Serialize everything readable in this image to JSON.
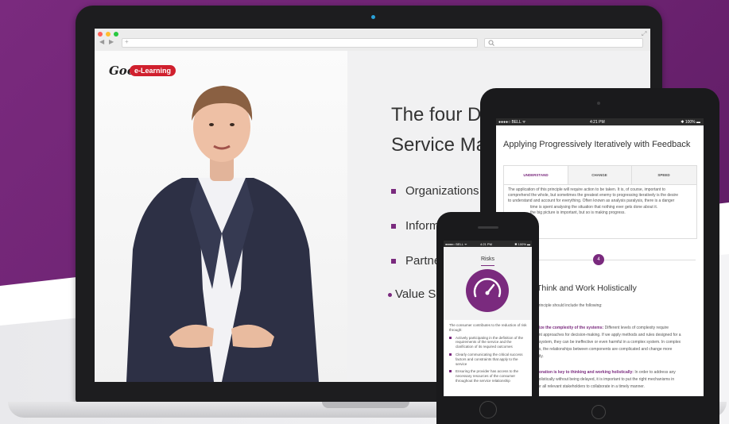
{
  "colors": {
    "brand_purple": "#7a2a7e",
    "logo_red": "#d0202e",
    "browser_close": "#ff5f57",
    "browser_min": "#ffbd2e",
    "browser_max": "#28c840"
  },
  "laptop": {
    "logo": {
      "good": "Good",
      "pill": "e-Learning"
    },
    "slide": {
      "title_line1": "The four D",
      "title_line2": "Service Ma",
      "bullets": [
        "Organizations",
        "Inform",
        "Partne",
        "Value S"
      ]
    }
  },
  "tablet": {
    "status": {
      "carrier": "●●●●○ BELL ᯤ",
      "time": "4:21 PM",
      "battery": "✱ 100% ▬"
    },
    "title": "Applying Progressively Iteratively with Feedback",
    "tabs": [
      "UNDERSTAND",
      "CHANGE",
      "SPEED"
    ],
    "panel_lines": [
      "The application of this principle will require action to be taken. It is, of course, important to",
      "comprehend the whole, but sometimes the greatest enemy to progressing iteratively is the desire",
      "to understand and account for everything. Often known as analysis paralysis, there is a danger",
      "time is spent analysing the situation that nothing ever gets done about it.",
      "the big picture is important, but so is making progress."
    ],
    "step_number": "4",
    "section_title": "Think and Work Holistically",
    "section_intro": "principle should include the following:",
    "point1_bold": "nize the complexity of the systems:",
    "point1_lines": [
      " Different levels of complexity require",
      "ent approaches for decision-making. If we apply methods and rules designed for a",
      "r system, they can be ineffective or even harmful in a complex system. In complex",
      "ns, the relationships between components are complicated and change more",
      "ntly."
    ],
    "point2_bold": "boration is key to thinking and working holistically:",
    "point2_lines": [
      " In order to address any",
      "holistically without being delayed, it is important to put the right mechanisms in",
      "for all relevant stakeholders to collaborate in a timely manner."
    ]
  },
  "phone": {
    "status": {
      "carrier": "●●●●○ BELL ᯤ",
      "time": "4:21 PM",
      "battery": "✱ 100% ▬"
    },
    "title": "Risks",
    "intro": "The consumer contributes to the reduction of risk through:",
    "items": [
      "Actively participating in the definition of the requirements of the service and the clarification of its required outcomes",
      "Clearly communicating the critical success factors and constraints that apply to the service",
      "Ensuring the provider has access to the necessary resources of the consumer throughout the service relationship"
    ]
  }
}
